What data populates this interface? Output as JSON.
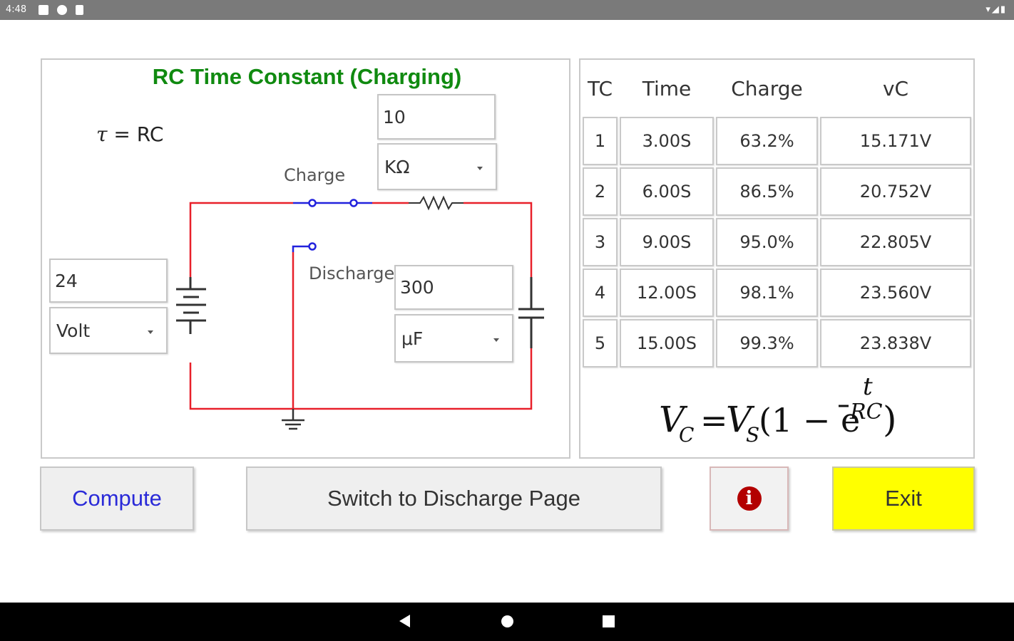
{
  "status_bar": {
    "time": "4:48"
  },
  "circuit": {
    "title": "RC Time Constant (Charging)",
    "tau_symbol": "τ",
    "tau_rhs": " = RC",
    "resistance_value": "10",
    "resistance_unit": "KΩ",
    "voltage_value": "24",
    "voltage_unit": "Volt",
    "capacitance_value": "300",
    "capacitance_unit": "μF",
    "charge_label": "Charge",
    "discharge_label": "Discharge",
    "wire_color": "#e8202a",
    "switch_color": "#2222dd"
  },
  "table": {
    "headers": [
      "TC",
      "Time",
      "Charge",
      "vC"
    ],
    "rows": [
      [
        "1",
        "3.00S",
        "63.2%",
        "15.171V"
      ],
      [
        "2",
        "6.00S",
        "86.5%",
        "20.752V"
      ],
      [
        "3",
        "9.00S",
        "95.0%",
        "22.805V"
      ],
      [
        "4",
        "12.00S",
        "98.1%",
        "23.560V"
      ],
      [
        "5",
        "15.00S",
        "99.3%",
        "23.838V"
      ]
    ]
  },
  "formula": {
    "lhs_var": "V",
    "lhs_sub": "C",
    "eq": "=",
    "vs_var": "V",
    "vs_sub": "S",
    "open": "(1 − e",
    "exp_num": "t",
    "exp_den": "RC",
    "close": ")"
  },
  "buttons": {
    "compute": "Compute",
    "switch": "Switch to Discharge Page",
    "info_glyph": "i",
    "exit": "Exit"
  },
  "colors": {
    "title_green": "#108a10",
    "compute_blue": "#2a2ad8",
    "exit_yellow": "#ffff00",
    "info_red": "#b30000"
  }
}
